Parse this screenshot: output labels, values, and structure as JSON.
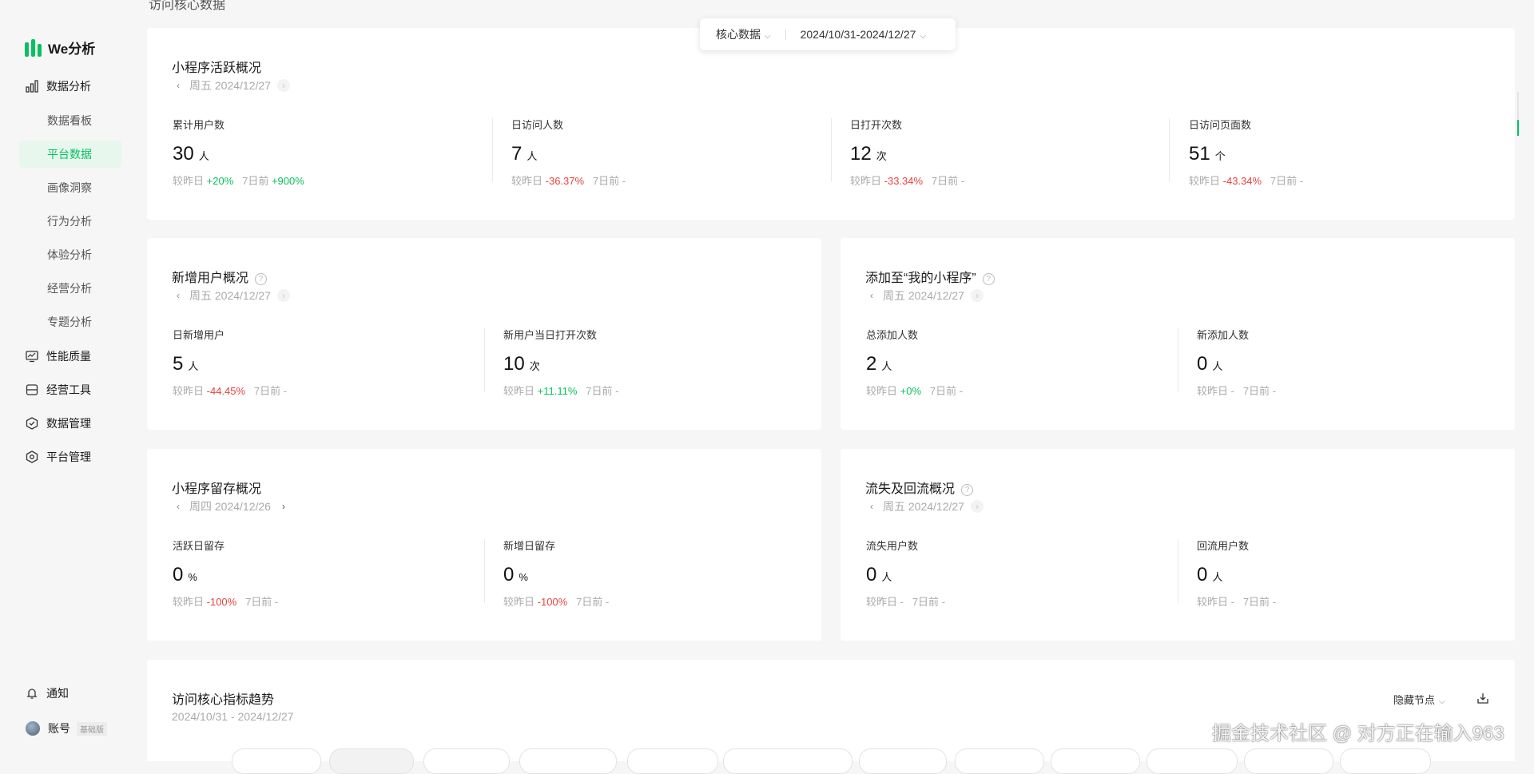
{
  "app": {
    "logo_text": "We分析"
  },
  "sidebar": {
    "groups": [
      {
        "label": "数据分析",
        "icon": "bar-chart-icon"
      },
      {
        "label": "性能质量",
        "icon": "monitor-icon"
      },
      {
        "label": "经营工具",
        "icon": "toolbox-icon"
      },
      {
        "label": "数据管理",
        "icon": "hexagon-check-icon"
      },
      {
        "label": "平台管理",
        "icon": "hexagon-gear-icon"
      }
    ],
    "sub_items": [
      "数据看板",
      "平台数据",
      "画像洞察",
      "行为分析",
      "体验分析",
      "经营分析",
      "专题分析"
    ],
    "active_sub": "平台数据",
    "bottom": {
      "notify": "通知",
      "account": "账号",
      "account_badge": "基础版"
    }
  },
  "section_title": "访问核心数据",
  "filter": {
    "scope": "核心数据",
    "date_range": "2024/10/31-2024/12/27"
  },
  "cards": {
    "active": {
      "title": "小程序活跃概况",
      "date": "周五 2024/12/27",
      "metrics": [
        {
          "label": "累计用户数",
          "value": "30",
          "unit": "人",
          "cmp_day_label": "较昨日",
          "cmp_day": "+20%",
          "cmp_day_dir": "up",
          "cmp_week_label": "7日前",
          "cmp_week": "+900%",
          "cmp_week_dir": "up"
        },
        {
          "label": "日访问人数",
          "value": "7",
          "unit": "人",
          "cmp_day_label": "较昨日",
          "cmp_day": "-36.37%",
          "cmp_day_dir": "down",
          "cmp_week_label": "7日前",
          "cmp_week": "-",
          "cmp_week_dir": "none"
        },
        {
          "label": "日打开次数",
          "value": "12",
          "unit": "次",
          "cmp_day_label": "较昨日",
          "cmp_day": "-33.34%",
          "cmp_day_dir": "down",
          "cmp_week_label": "7日前",
          "cmp_week": "-",
          "cmp_week_dir": "none"
        },
        {
          "label": "日访问页面数",
          "value": "51",
          "unit": "个",
          "cmp_day_label": "较昨日",
          "cmp_day": "-43.34%",
          "cmp_day_dir": "down",
          "cmp_week_label": "7日前",
          "cmp_week": "-",
          "cmp_week_dir": "none"
        }
      ]
    },
    "new_users": {
      "title": "新增用户概况",
      "date": "周五 2024/12/27",
      "metrics": [
        {
          "label": "日新增用户",
          "value": "5",
          "unit": "人",
          "cmp_day_label": "较昨日",
          "cmp_day": "-44.45%",
          "cmp_day_dir": "down",
          "cmp_week_label": "7日前",
          "cmp_week": "-",
          "cmp_week_dir": "none"
        },
        {
          "label": "新用户当日打开次数",
          "value": "10",
          "unit": "次",
          "cmp_day_label": "较昨日",
          "cmp_day": "+11.11%",
          "cmp_day_dir": "up",
          "cmp_week_label": "7日前",
          "cmp_week": "-",
          "cmp_week_dir": "none"
        }
      ]
    },
    "added": {
      "title": "添加至“我的小程序”",
      "date": "周五 2024/12/27",
      "metrics": [
        {
          "label": "总添加人数",
          "value": "2",
          "unit": "人",
          "cmp_day_label": "较昨日",
          "cmp_day": "+0%",
          "cmp_day_dir": "up",
          "cmp_week_label": "7日前",
          "cmp_week": "-",
          "cmp_week_dir": "none"
        },
        {
          "label": "新添加人数",
          "value": "0",
          "unit": "人",
          "cmp_day_label": "较昨日",
          "cmp_day": "-",
          "cmp_day_dir": "none",
          "cmp_week_label": "7日前",
          "cmp_week": "-",
          "cmp_week_dir": "none"
        }
      ]
    },
    "retention": {
      "title": "小程序留存概况",
      "date": "周四 2024/12/26",
      "metrics": [
        {
          "label": "活跃日留存",
          "value": "0",
          "unit": "%",
          "cmp_day_label": "较昨日",
          "cmp_day": "-100%",
          "cmp_day_dir": "down",
          "cmp_week_label": "7日前",
          "cmp_week": "-",
          "cmp_week_dir": "none"
        },
        {
          "label": "新增日留存",
          "value": "0",
          "unit": "%",
          "cmp_day_label": "较昨日",
          "cmp_day": "-100%",
          "cmp_day_dir": "down",
          "cmp_week_label": "7日前",
          "cmp_week": "-",
          "cmp_week_dir": "none"
        }
      ]
    },
    "churn": {
      "title": "流失及回流概况",
      "date": "周五 2024/12/27",
      "metrics": [
        {
          "label": "流失用户数",
          "value": "0",
          "unit": "人",
          "cmp_day_label": "较昨日",
          "cmp_day": "-",
          "cmp_day_dir": "none",
          "cmp_week_label": "7日前",
          "cmp_week": "-",
          "cmp_week_dir": "none"
        },
        {
          "label": "回流用户数",
          "value": "0",
          "unit": "人",
          "cmp_day_label": "较昨日",
          "cmp_day": "-",
          "cmp_day_dir": "none",
          "cmp_week_label": "7日前",
          "cmp_week": "-",
          "cmp_week_dir": "none"
        }
      ]
    }
  },
  "trend": {
    "title": "访问核心指标趋势",
    "date_range": "2024/10/31 - 2024/12/27",
    "hide_nodes": "隐藏节点"
  },
  "watermark": "掘金技术社区 @ 对方正在输入963",
  "colors": {
    "brand": "#07c160",
    "up": "#07c160",
    "down": "#e64340"
  }
}
